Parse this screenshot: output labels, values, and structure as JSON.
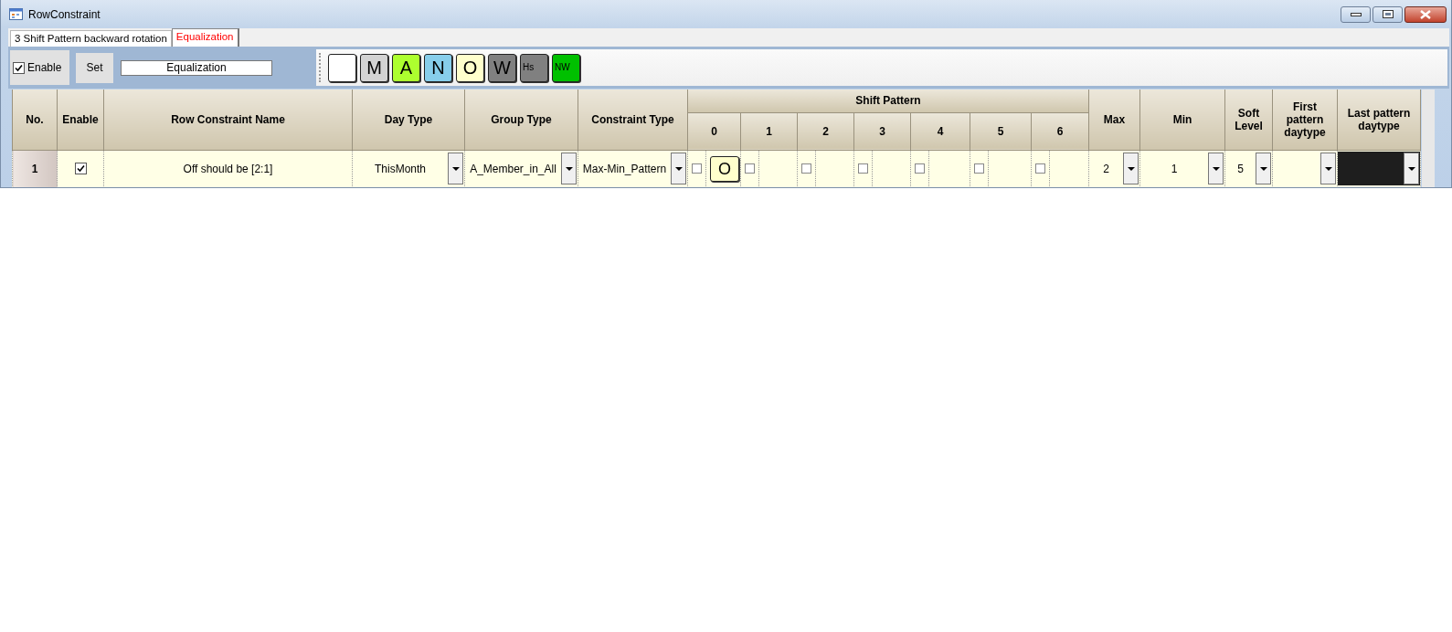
{
  "window": {
    "title": "RowConstraint"
  },
  "tabs": [
    {
      "label": "3 Shift Pattern backward rotation",
      "selected": false
    },
    {
      "label": "Equalization",
      "selected": true
    }
  ],
  "toolbar": {
    "enable": {
      "label": "Enable",
      "checked": true
    },
    "set_button": "Set",
    "name_field": "Equalization"
  },
  "shift_buttons": [
    {
      "color": "#ffffff"
    },
    {
      "label": "M",
      "color": "#d3d3d3"
    },
    {
      "label": "A",
      "color": "#adff2f"
    },
    {
      "label": "N",
      "color": "#87ceeb"
    },
    {
      "label": "O",
      "color": "#ffffcc"
    },
    {
      "label": "W",
      "color": "#808080"
    },
    {
      "label": "Hs",
      "color": "#808080",
      "kind": "small"
    },
    {
      "label": "NW",
      "color": "#00c000",
      "kind": "small"
    }
  ],
  "table": {
    "columns": [
      "No.",
      "Enable",
      "Row Constraint Name",
      "Day Type",
      "Group Type",
      "Constraint Type"
    ],
    "shift_pattern": {
      "title": "Shift Pattern",
      "columns": [
        "0",
        "1",
        "2",
        "3",
        "4",
        "5",
        "6"
      ]
    },
    "columns_after": [
      "Max",
      "Min",
      "Soft Level",
      "First pattern daytype",
      "Last pattern daytype"
    ],
    "rows": [
      {
        "no": "1",
        "enabled": true,
        "name": "Off should be [2:1]",
        "day_type": {
          "value": "ThisMonth",
          "selected": false
        },
        "group_type": {
          "value": "A_Member_in_All",
          "selected": false
        },
        "constraint_type": {
          "value": "Max-Min_Pattern",
          "selected": false
        },
        "shift_pattern": [
          {
            "checked": false,
            "shift": "O",
            "color": "#ffffcc"
          },
          {
            "checked": false
          },
          {
            "checked": false
          },
          {
            "checked": false
          },
          {
            "checked": false
          },
          {
            "checked": false
          },
          {
            "checked": false
          }
        ],
        "max": {
          "value": "2",
          "selected": false
        },
        "min": {
          "value": "1",
          "selected": false
        },
        "soft_level": {
          "value": "5",
          "selected": false
        },
        "first_pattern_daytype": {
          "selected": false
        },
        "last_pattern_daytype": {
          "selected": true
        }
      }
    ]
  }
}
